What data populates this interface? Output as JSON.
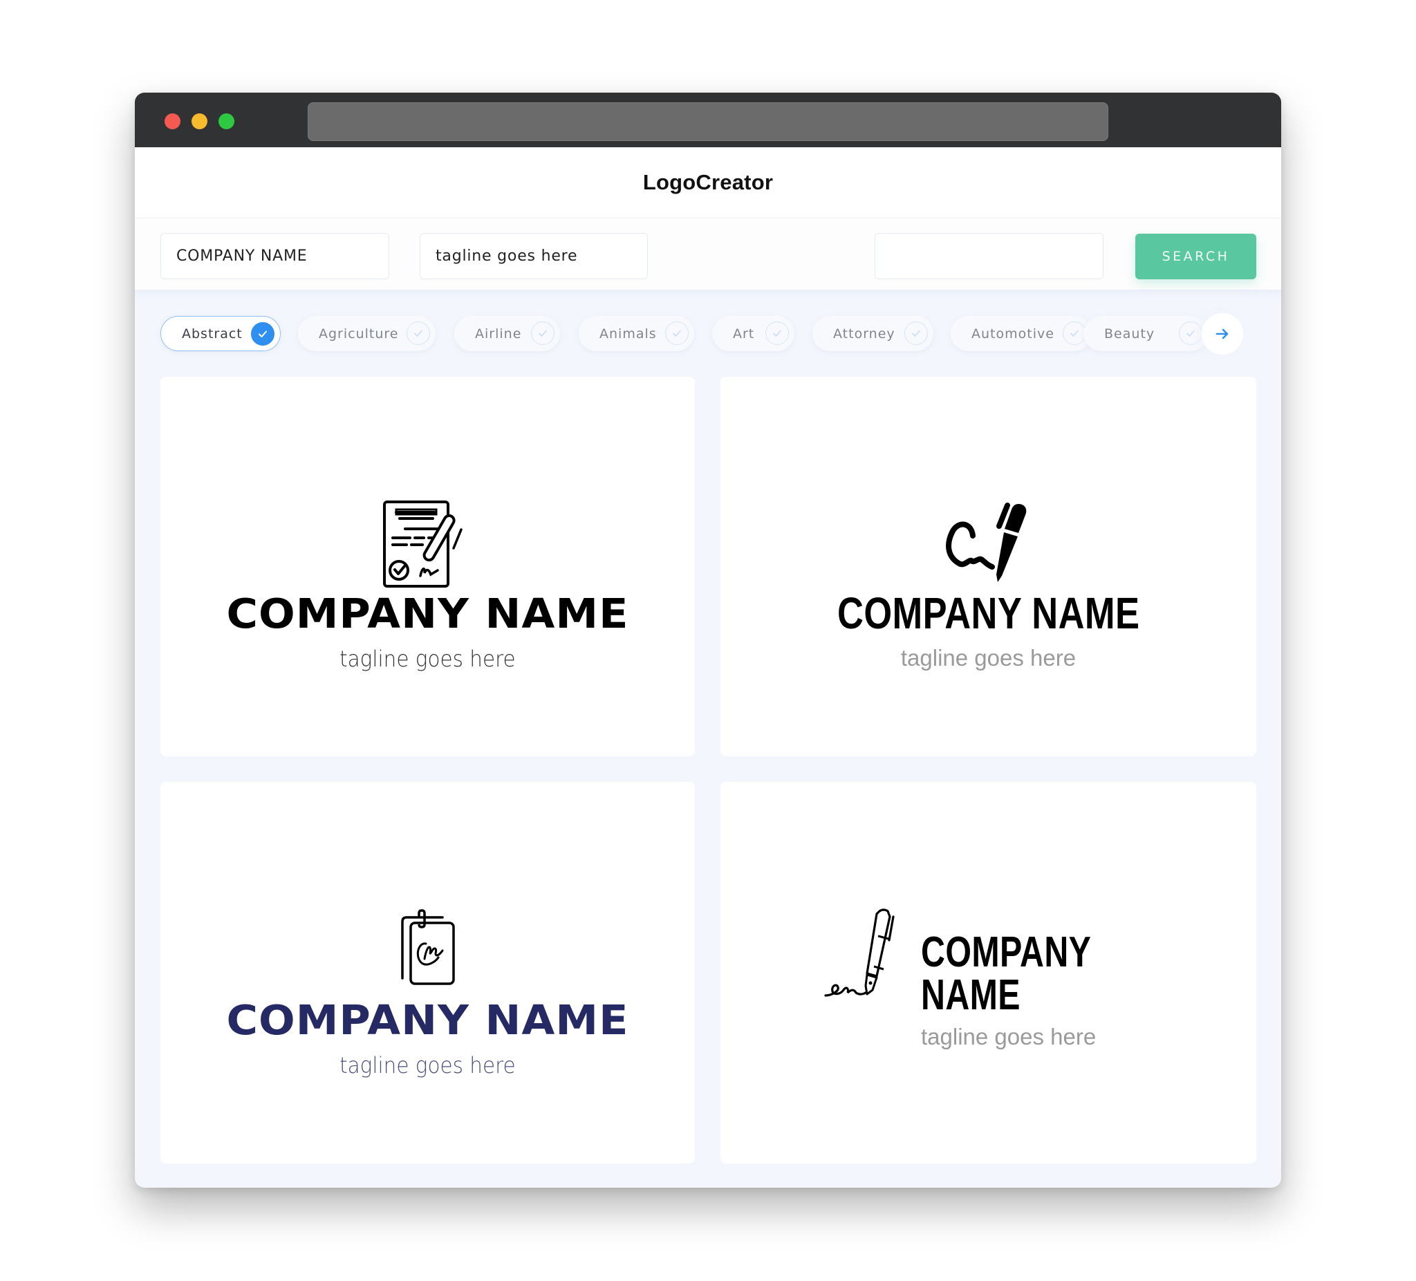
{
  "window": {
    "controls": [
      "close",
      "minimize",
      "maximize"
    ],
    "address_bar": ""
  },
  "header": {
    "title": "LogoCreator"
  },
  "toolbar": {
    "company_field": {
      "value": "COMPANY NAME"
    },
    "tagline_field": {
      "value": "tagline goes here"
    },
    "search_field": {
      "value": "",
      "placeholder": ""
    },
    "search_label": "SEARCH"
  },
  "categories": {
    "items": [
      {
        "label": "Abstract",
        "selected": true
      },
      {
        "label": "Agriculture",
        "selected": false
      },
      {
        "label": "Airline",
        "selected": false
      },
      {
        "label": "Animals",
        "selected": false
      },
      {
        "label": "Art",
        "selected": false
      },
      {
        "label": "Attorney",
        "selected": false
      },
      {
        "label": "Automotive",
        "selected": false
      },
      {
        "label": "Beauty",
        "selected": false
      }
    ],
    "next_icon": "arrow-right-icon"
  },
  "colors": {
    "accent_green": "#59c8a0",
    "accent_blue": "#2f8ff0",
    "navy": "#262a64",
    "page_bg": "#f3f6fd"
  },
  "logos": [
    {
      "icon": "signed-document-pen-icon",
      "company": "COMPANY NAME",
      "tagline": "tagline goes here",
      "name_color": "#000000",
      "tagline_color": "#333333"
    },
    {
      "icon": "signature-pen-icon",
      "company": "COMPANY NAME",
      "tagline": "tagline goes here",
      "name_color": "#000000",
      "tagline_color": "#999999"
    },
    {
      "icon": "clipboard-signature-icon",
      "company": "COMPANY NAME",
      "tagline": "tagline goes here",
      "name_color": "#262a64",
      "tagline_color": "#4a4e7e"
    },
    {
      "icon": "fountain-pen-signature-icon",
      "company": "COMPANY NAME",
      "tagline": "tagline goes here",
      "name_color": "#000000",
      "tagline_color": "#9a9a9a"
    }
  ]
}
